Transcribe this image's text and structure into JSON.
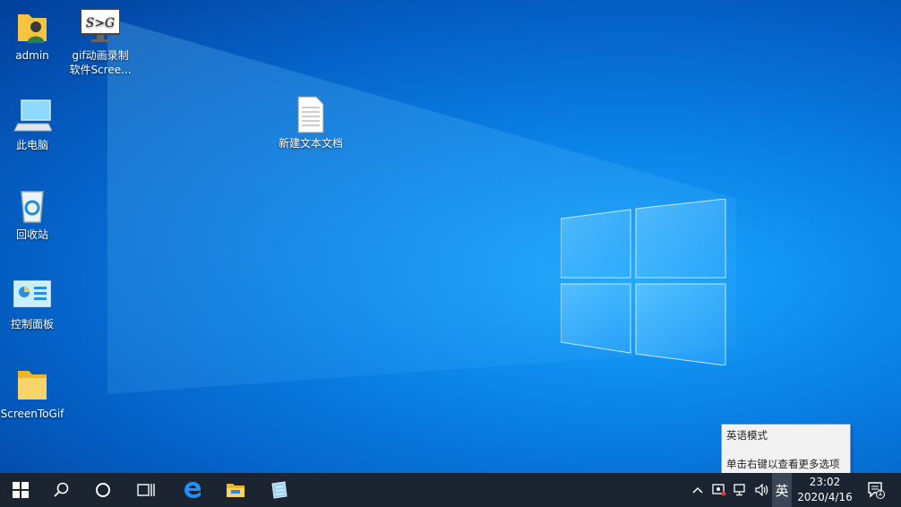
{
  "desktop": {
    "icons": [
      {
        "label": "admin"
      },
      {
        "label": "gif动画录制软件Scree..."
      },
      {
        "label": "此电脑"
      },
      {
        "label": "回收站"
      },
      {
        "label": "控制面板"
      },
      {
        "label": "ScreenToGif"
      },
      {
        "label": "新建文本文档"
      }
    ],
    "gif_icon_text": "S>G"
  },
  "tooltip": {
    "mode": "英语模式",
    "hint": "单击右键以查看更多选项"
  },
  "taskbar": {
    "ime_label": "英",
    "time": "23:02",
    "date": "2020/4/16",
    "notification_count": "1"
  },
  "colors": {
    "taskbar_bg": "#1b2430",
    "desktop_blue": "#0a82e6",
    "folder_yellow": "#f5c542"
  }
}
